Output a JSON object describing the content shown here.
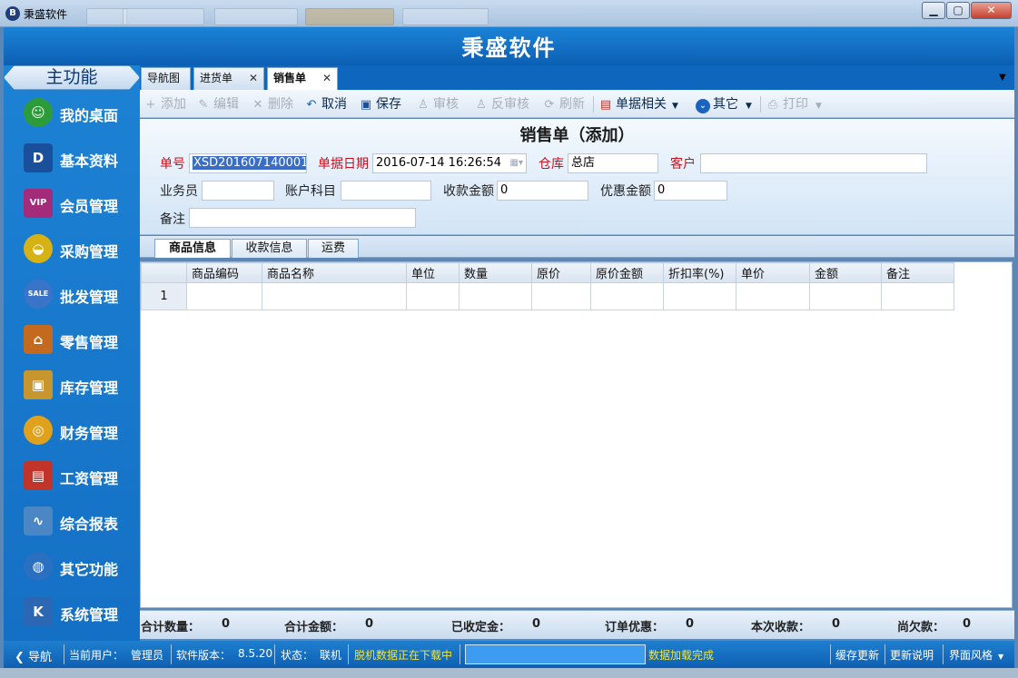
{
  "window": {
    "title": "秉盛软件",
    "logo_letter": "B",
    "min": "▁",
    "max": "▢",
    "close": "✕"
  },
  "header": {
    "title": "秉盛软件"
  },
  "sidebar": {
    "title": "主功能",
    "items": [
      {
        "label": "我的桌面",
        "icon": "desktop-user-icon",
        "color": "#2e9b3a"
      },
      {
        "label": "基本资料",
        "icon": "data-d-icon",
        "color": "#1a4f9c"
      },
      {
        "label": "会员管理",
        "icon": "vip-icon",
        "color": "#a32b7a"
      },
      {
        "label": "采购管理",
        "icon": "basket-icon",
        "color": "#d7b215"
      },
      {
        "label": "批发管理",
        "icon": "sale-icon",
        "color": "#3a74c9"
      },
      {
        "label": "零售管理",
        "icon": "store-icon",
        "color": "#c46a1e"
      },
      {
        "label": "库存管理",
        "icon": "box-icon",
        "color": "#c8962f"
      },
      {
        "label": "财务管理",
        "icon": "coins-icon",
        "color": "#e0a21d"
      },
      {
        "label": "工资管理",
        "icon": "payroll-icon",
        "color": "#c0342a"
      },
      {
        "label": "综合报表",
        "icon": "report-chart-icon",
        "color": "#4b87c5"
      },
      {
        "label": "其它功能",
        "icon": "globe-icon",
        "color": "#2b6fc1"
      },
      {
        "label": "系统管理",
        "icon": "system-icon",
        "color": "#2b67b3"
      }
    ]
  },
  "tabs": [
    {
      "label": "导航图",
      "closable": false
    },
    {
      "label": "进货单",
      "closable": true
    },
    {
      "label": "销售单",
      "closable": true,
      "active": true
    }
  ],
  "toolbar": {
    "add": "添加",
    "edit": "编辑",
    "delete": "删除",
    "cancel": "取消",
    "save": "保存",
    "audit": "审核",
    "unaudit": "反审核",
    "refresh": "刷新",
    "doc_related": "单据相关",
    "other": "其它",
    "print": "打印"
  },
  "form": {
    "title": "销售单（添加）",
    "number_label": "单号",
    "number_value": "XSD201607140001",
    "date_label": "单据日期",
    "date_value": "2016-07-14 16:26:54",
    "warehouse_label": "仓库",
    "warehouse_value": "总店",
    "customer_label": "客户",
    "customer_value": "",
    "salesman_label": "业务员",
    "salesman_value": "",
    "account_label": "账户科目",
    "account_value": "",
    "received_label": "收款金额",
    "received_value": "0",
    "discount_label": "优惠金额",
    "discount_value": "0",
    "remark_label": "备注",
    "remark_value": ""
  },
  "subtabs": [
    "商品信息",
    "收款信息",
    "运费"
  ],
  "grid": {
    "columns": [
      "",
      "商品编码",
      "商品名称",
      "单位",
      "数量",
      "原价",
      "原价金额",
      "折扣率(%)",
      "单价",
      "金额",
      "备注"
    ],
    "rows": [
      [
        "1",
        "",
        "",
        "",
        "",
        "",
        "",
        "",
        "",
        "",
        ""
      ]
    ]
  },
  "summary": {
    "total_qty_label": "合计数量：",
    "total_qty": "0",
    "total_amount_label": "合计金额：",
    "total_amount": "0",
    "deposit_label": "已收定金：",
    "deposit": "0",
    "order_discount_label": "订单优惠：",
    "order_discount": "0",
    "this_receipt_label": "本次收款：",
    "this_receipt": "0",
    "owed_label": "尚欠款：",
    "owed": "0"
  },
  "statusbar": {
    "nav": "导航",
    "current_user_label": "当前用户：",
    "current_user": "管理员",
    "version_label": "软件版本：",
    "version": "8.5.20",
    "state_label": "状态：",
    "state": "联机",
    "offline_msg": "脱机数据正在下载中",
    "load_msg": "数据加载完成",
    "cache_update": "缓存更新",
    "update_notes": "更新说明",
    "ui_style": "界面风格"
  }
}
